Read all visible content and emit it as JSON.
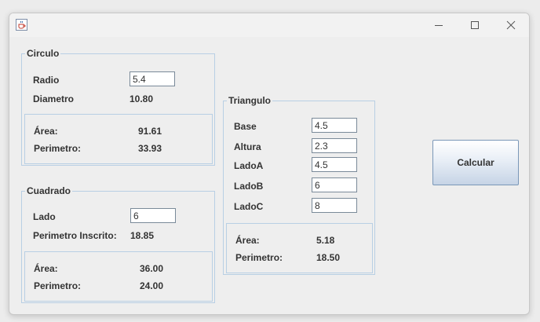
{
  "window": {
    "icon": "java-coffee-cup-icon",
    "controls": {
      "minimize": "minimize-icon",
      "maximize": "maximize-icon",
      "close": "close-icon"
    }
  },
  "circulo": {
    "title": "Circulo",
    "radio_label": "Radio",
    "radio_value": "5.4",
    "diametro_label": "Diametro",
    "diametro_value": "10.80",
    "area_label": "Área:",
    "area_value": "91.61",
    "perimetro_label": "Perimetro:",
    "perimetro_value": "33.93"
  },
  "cuadrado": {
    "title": "Cuadrado",
    "lado_label": "Lado",
    "lado_value": "6",
    "perimetro_inscrito_label": "Perimetro Inscrito:",
    "perimetro_inscrito_value": "18.85",
    "area_label": "Área:",
    "area_value": "36.00",
    "perimetro_label": "Perimetro:",
    "perimetro_value": "24.00"
  },
  "triangulo": {
    "title": "Triangulo",
    "base_label": "Base",
    "base_value": "4.5",
    "altura_label": "Altura",
    "altura_value": "2.3",
    "ladoA_label": "LadoA",
    "ladoA_value": "4.5",
    "ladoB_label": "LadoB",
    "ladoB_value": "6",
    "ladoC_label": "LadoC",
    "ladoC_value": "8",
    "area_label": "Área:",
    "area_value": "5.18",
    "perimetro_label": "Perimetro:",
    "perimetro_value": "18.50"
  },
  "actions": {
    "calcular_label": "Calcular"
  },
  "colors": {
    "group_border": "#b8cfe4",
    "button_gradient_bottom": "#c6d4e6",
    "background": "#eeeeee"
  }
}
